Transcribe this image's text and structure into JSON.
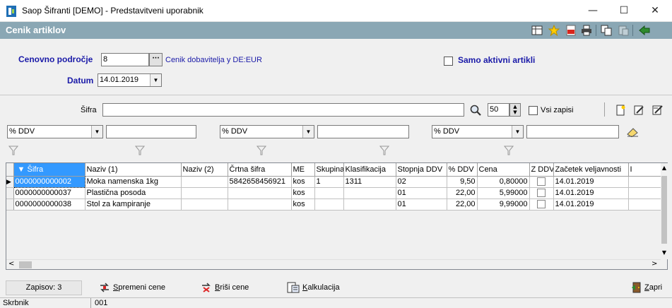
{
  "window": {
    "title": "Saop Šifranti  [DEMO] - Predstavitveni uporabnik",
    "minimize": "—",
    "maximize": "☐",
    "close": "✕"
  },
  "header": {
    "title": "Cenik artiklov"
  },
  "form": {
    "price_area_label": "Cenovno področje",
    "price_area_value": "8",
    "ellipsis": "···",
    "price_area_description": "Cenik dobavitelja y  DE:EUR",
    "only_active_label": "Samo aktivni artikli",
    "date_label": "Datum",
    "date_value": "14.01.2019"
  },
  "search": {
    "code_label": "Šifra",
    "code_value": "",
    "limit_value": "50",
    "all_records_label": "Vsi zapisi"
  },
  "filters": [
    {
      "field": "% DDV",
      "value": ""
    },
    {
      "field": "% DDV",
      "value": ""
    },
    {
      "field": "% DDV",
      "value": ""
    }
  ],
  "table": {
    "columns": [
      "Šifra",
      "Naziv (1)",
      "Naziv (2)",
      "Črtna šifra",
      "ME",
      "Skupina",
      "Klasifikacija",
      "Stopnja DDV",
      "% DDV",
      "Cena",
      "Z DDV",
      "Začetek veljavnosti",
      "I"
    ],
    "rows": [
      {
        "sifra": "0000000000002",
        "naziv1": "Moka namenska 1kg",
        "naziv2": "",
        "crtna": "5842658456921",
        "me": "kos",
        "skupina": "1",
        "klasifikacija": "1311",
        "stopnja": "02",
        "ddv": "9,50",
        "cena": "0,80000",
        "zddv": false,
        "zacetek": "14.01.2019"
      },
      {
        "sifra": "0000000000037",
        "naziv1": "Plastična posoda",
        "naziv2": "",
        "crtna": "",
        "me": "kos",
        "skupina": "",
        "klasifikacija": "",
        "stopnja": "01",
        "ddv": "22,00",
        "cena": "5,99000",
        "zddv": false,
        "zacetek": "14.01.2019"
      },
      {
        "sifra": "0000000000038",
        "naziv1": "Stol za kampiranje",
        "naziv2": "",
        "crtna": "",
        "me": "kos",
        "skupina": "",
        "klasifikacija": "",
        "stopnja": "01",
        "ddv": "22,00",
        "cena": "9,99000",
        "zddv": false,
        "zacetek": "14.01.2019"
      }
    ]
  },
  "bottom": {
    "records_count": "Zapisov: 3",
    "change_prices": "Spremeni cene",
    "delete_prices": "Briši cene",
    "calculation": "Kalkulacija",
    "close": "Zapri"
  },
  "footer": {
    "label": "Skrbnik",
    "value": "001"
  },
  "colors": {
    "header_band": "#8aa7b4",
    "label_blue": "#1a1aa8",
    "selection": "#3399ff"
  }
}
